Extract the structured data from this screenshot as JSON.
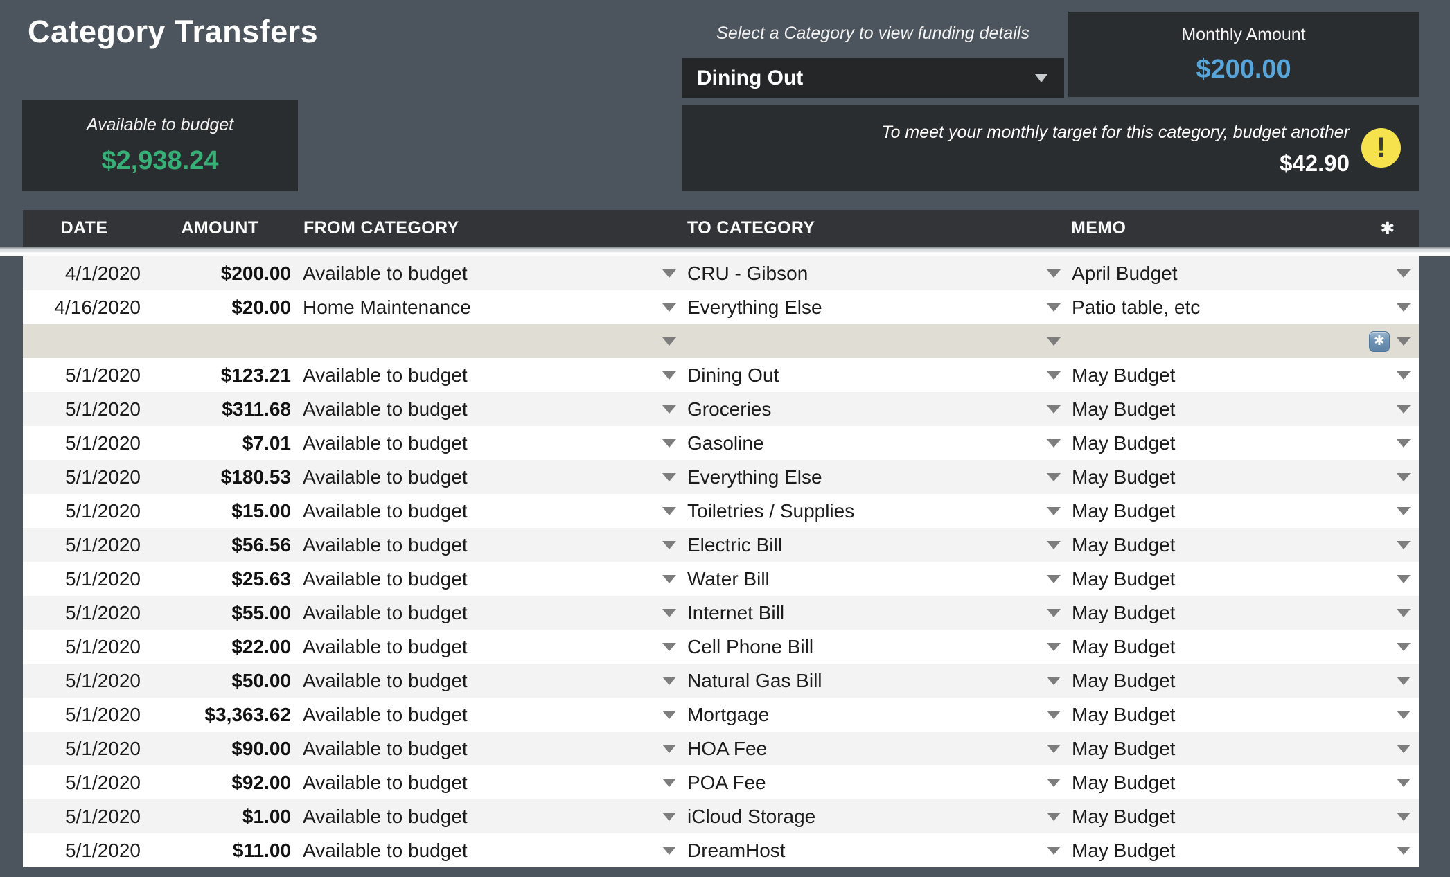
{
  "header": {
    "title": "Category Transfers"
  },
  "summary": {
    "available_label": "Available to budget",
    "available_value": "$2,938.24",
    "select_hint": "Select a Category to view funding details",
    "selected_category": "Dining Out",
    "monthly_label": "Monthly Amount",
    "monthly_value": "$200.00",
    "target_message": "To meet your monthly target for this category, budget another",
    "target_amount": "$42.90",
    "alert_glyph": "!"
  },
  "table": {
    "headers": [
      "DATE",
      "AMOUNT",
      "FROM CATEGORY",
      "TO CATEGORY",
      "MEMO"
    ],
    "header_star_glyph": "✱",
    "keycap_glyph": "✱",
    "rows": [
      {
        "date": "4/1/2020",
        "amount": "$200.00",
        "from": "Available to budget",
        "to": "CRU - Gibson",
        "memo": "April Budget",
        "special": false
      },
      {
        "date": "4/16/2020",
        "amount": "$20.00",
        "from": "Home Maintenance",
        "to": "Everything Else",
        "memo": "Patio table, etc",
        "special": false
      },
      {
        "date": "",
        "amount": "",
        "from": "",
        "to": "",
        "memo": "",
        "special": true
      },
      {
        "date": "5/1/2020",
        "amount": "$123.21",
        "from": "Available to budget",
        "to": "Dining Out",
        "memo": "May Budget",
        "special": false
      },
      {
        "date": "5/1/2020",
        "amount": "$311.68",
        "from": "Available to budget",
        "to": "Groceries",
        "memo": "May Budget",
        "special": false
      },
      {
        "date": "5/1/2020",
        "amount": "$7.01",
        "from": "Available to budget",
        "to": "Gasoline",
        "memo": "May Budget",
        "special": false
      },
      {
        "date": "5/1/2020",
        "amount": "$180.53",
        "from": "Available to budget",
        "to": "Everything Else",
        "memo": "May Budget",
        "special": false
      },
      {
        "date": "5/1/2020",
        "amount": "$15.00",
        "from": "Available to budget",
        "to": "Toiletries / Supplies",
        "memo": "May Budget",
        "special": false
      },
      {
        "date": "5/1/2020",
        "amount": "$56.56",
        "from": "Available to budget",
        "to": "Electric Bill",
        "memo": "May Budget",
        "special": false
      },
      {
        "date": "5/1/2020",
        "amount": "$25.63",
        "from": "Available to budget",
        "to": "Water Bill",
        "memo": "May Budget",
        "special": false
      },
      {
        "date": "5/1/2020",
        "amount": "$55.00",
        "from": "Available to budget",
        "to": "Internet Bill",
        "memo": "May Budget",
        "special": false
      },
      {
        "date": "5/1/2020",
        "amount": "$22.00",
        "from": "Available to budget",
        "to": "Cell Phone Bill",
        "memo": "May Budget",
        "special": false
      },
      {
        "date": "5/1/2020",
        "amount": "$50.00",
        "from": "Available to budget",
        "to": "Natural Gas Bill",
        "memo": "May Budget",
        "special": false
      },
      {
        "date": "5/1/2020",
        "amount": "$3,363.62",
        "from": "Available to budget",
        "to": "Mortgage",
        "memo": "May Budget",
        "special": false
      },
      {
        "date": "5/1/2020",
        "amount": "$90.00",
        "from": "Available to budget",
        "to": "HOA Fee",
        "memo": "May Budget",
        "special": false
      },
      {
        "date": "5/1/2020",
        "amount": "$92.00",
        "from": "Available to budget",
        "to": "POA Fee",
        "memo": "May Budget",
        "special": false
      },
      {
        "date": "5/1/2020",
        "amount": "$1.00",
        "from": "Available to budget",
        "to": "iCloud Storage",
        "memo": "May Budget",
        "special": false
      },
      {
        "date": "5/1/2020",
        "amount": "$11.00",
        "from": "Available to budget",
        "to": "DreamHost",
        "memo": "May Budget",
        "special": false
      }
    ]
  },
  "colors": {
    "page_bg": "#4c555d",
    "panel_bg": "#2a2d2f",
    "select_bg": "#242627",
    "header_bg": "#323437",
    "accent_green": "#36b077",
    "accent_blue": "#58a5d9",
    "warning_yellow": "#f6e24c",
    "row_odd": "#f3f3f4",
    "row_highlight": "#e0ddd5",
    "caret_color": "#7d7d7d"
  }
}
